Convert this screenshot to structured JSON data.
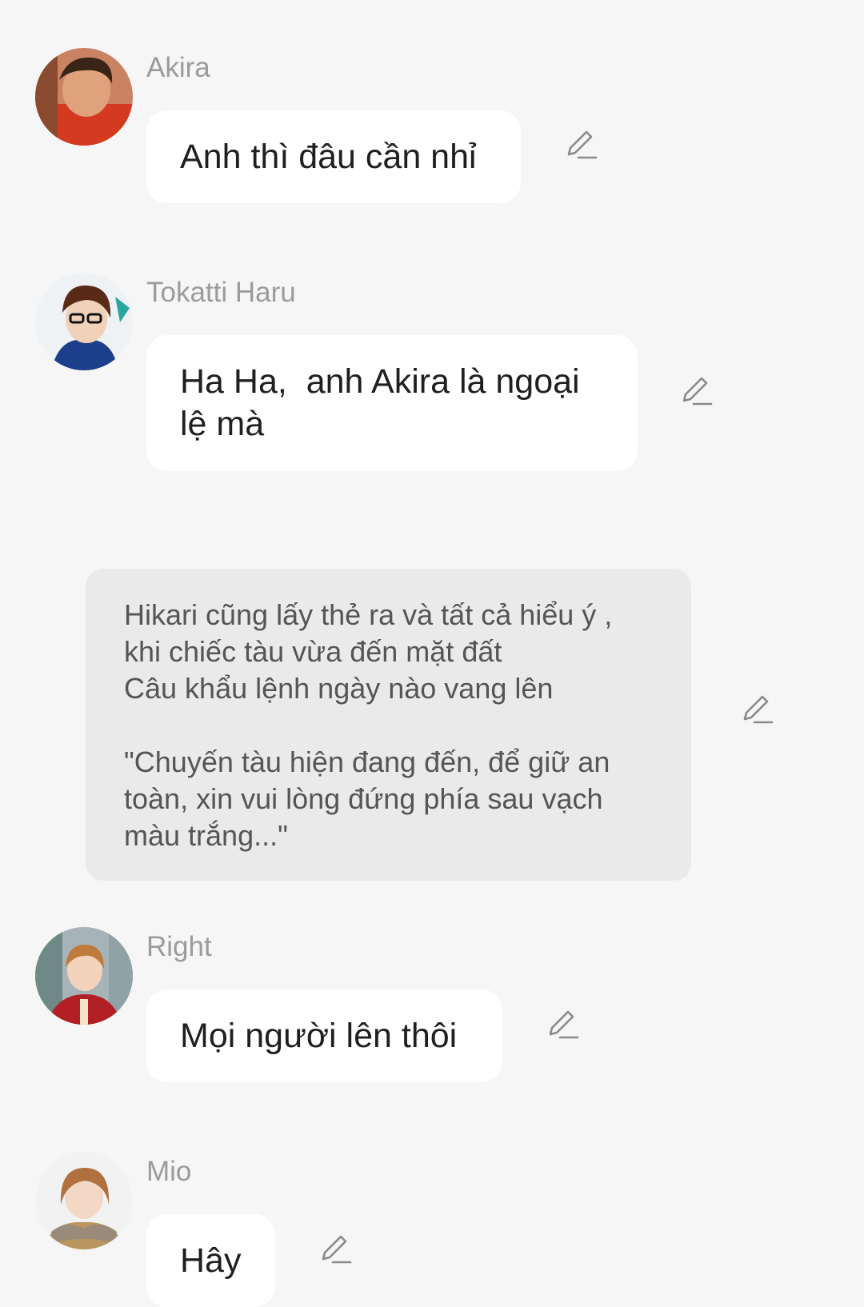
{
  "messages": [
    {
      "sender": "Akira",
      "text": "Anh thì đâu cần nhỉ"
    },
    {
      "sender": "Tokatti Haru",
      "text": "Ha Ha,  anh Akira là ngoại\nlệ mà"
    },
    {
      "narration": "Hikari cũng lấy thẻ ra và tất cả hiểu ý ,\nkhi chiếc tàu vừa đến mặt đất\nCâu khẩu lệnh ngày nào vang lên\n\n\"Chuyến tàu hiện đang đến, để giữ an\ntoàn, xin vui lòng đứng phía sau vạch\nmàu trắng...\""
    },
    {
      "sender": "Right",
      "text": "Mọi người lên thôi"
    },
    {
      "sender": "Mio",
      "text": "Hây"
    }
  ],
  "icons": {
    "edit": "pencil-edit-icon",
    "avatar": "avatar-photo"
  },
  "colors": {
    "background": "#f6f6f6",
    "bubble": "#ffffff",
    "narration": "#eaeaea",
    "sender_name": "#9b9b9b",
    "icon": "#8a8a8a"
  }
}
